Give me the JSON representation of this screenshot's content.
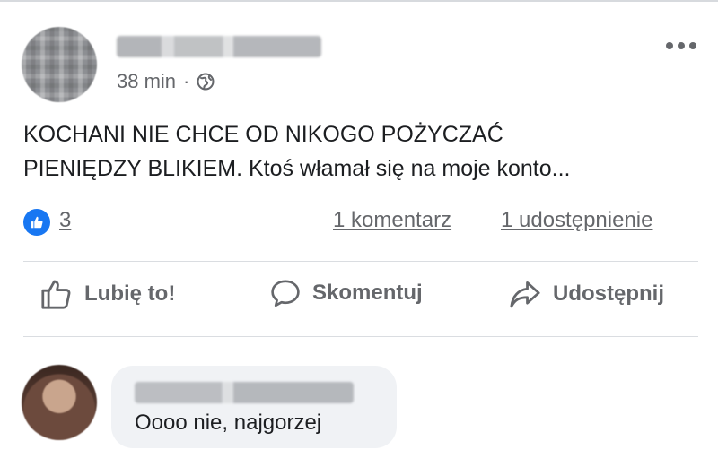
{
  "post": {
    "author_name": "",
    "time": "38 min",
    "separator": "·",
    "privacy_icon": "globe-icon",
    "more_icon": "more-options-icon",
    "text_line1": "KOCHANI NIE CHCE OD NIKOGO POŻYCZAĆ",
    "text_line2": "PIENIĘDZY BLIKIEM. Ktoś włamał się na moje konto..."
  },
  "stats": {
    "reaction_icon": "like-reaction-icon",
    "likes": "3",
    "comments": "1 komentarz",
    "shares": "1 udostępnienie"
  },
  "actions": {
    "like": "Lubię to!",
    "comment": "Skomentuj",
    "share": "Udostępnij"
  },
  "comment": {
    "author_name": "",
    "text": "Oooo nie, najgorzej",
    "bubble_color": "#f0f2f5"
  },
  "colors": {
    "accent": "#1877f2",
    "secondary_text": "#65676b",
    "primary_text": "#1c1e21"
  }
}
